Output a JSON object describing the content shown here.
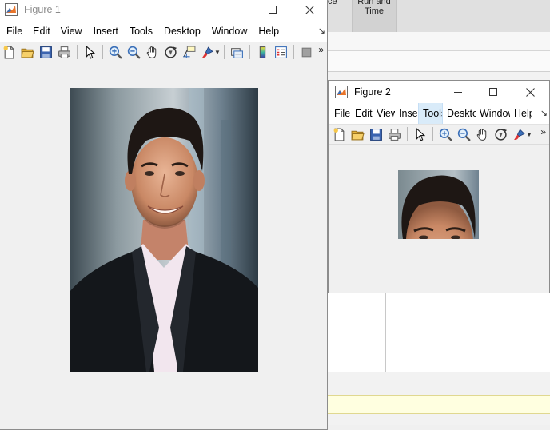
{
  "background": {
    "ribbon_frag": "ce",
    "ribbon_button_line1": "Run and",
    "ribbon_button_line2": "Time"
  },
  "figure1": {
    "title": "Figure 1",
    "menu": [
      "File",
      "Edit",
      "View",
      "Insert",
      "Tools",
      "Desktop",
      "Window",
      "Help"
    ],
    "image": "portrait photo of smiling man in dark blazer"
  },
  "figure2": {
    "title": "Figure 2",
    "menu": [
      "File",
      "Edit",
      "View",
      "Insert",
      "Tools",
      "Desktop",
      "Window",
      "Help"
    ],
    "hovered_menu": "Tools",
    "image": "cropped region of the eyes and hair"
  },
  "colors": {
    "titlebar": "#ffffff",
    "figure_bg": "#f0f0f0",
    "menu_hover": "#d9ebf9",
    "cmd_bg": "#ffffe0"
  }
}
